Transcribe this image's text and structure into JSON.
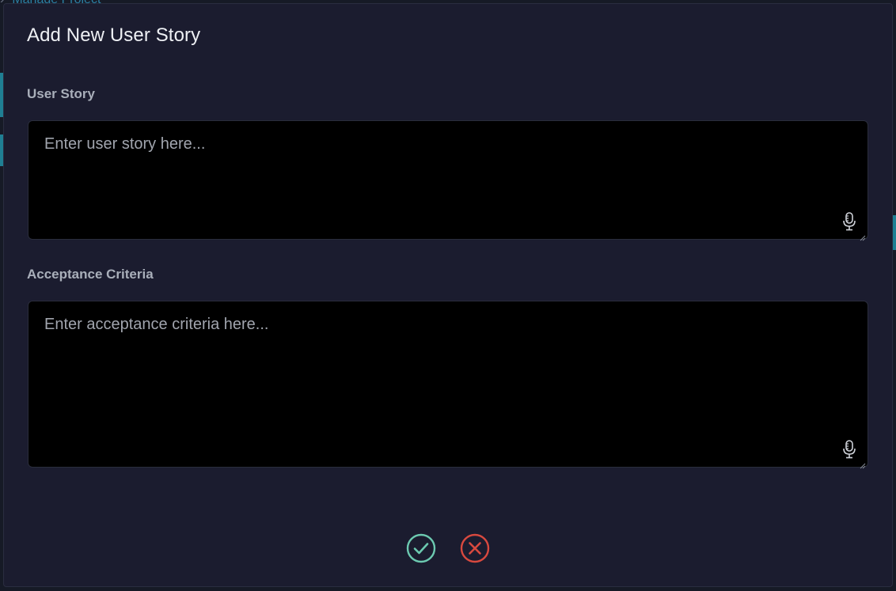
{
  "background": {
    "breadcrumb_current": "Manage Project"
  },
  "modal": {
    "title": "Add New User Story",
    "user_story": {
      "label": "User Story",
      "value": "",
      "placeholder": "Enter user story here..."
    },
    "acceptance_criteria": {
      "label": "Acceptance Criteria",
      "value": "",
      "placeholder": "Enter acceptance criteria here..."
    },
    "icons": {
      "mic": "microphone-icon",
      "confirm": "check-circle-icon",
      "cancel": "x-circle-icon"
    }
  },
  "colors": {
    "modal_bg": "#1b1c2f",
    "textarea_bg": "#000000",
    "confirm": "#6cc9b0",
    "cancel": "#d8493f",
    "label": "#a9afba"
  }
}
